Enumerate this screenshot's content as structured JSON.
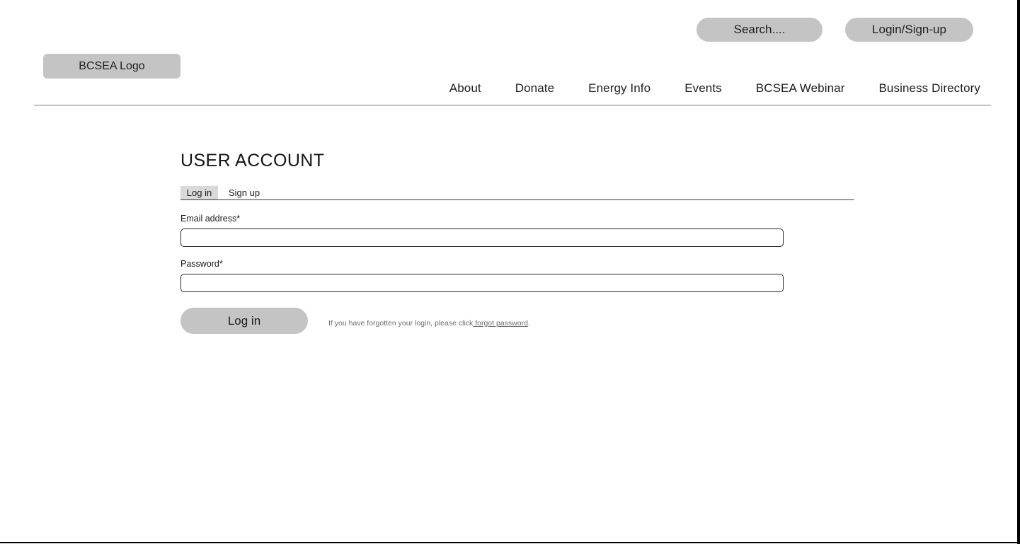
{
  "header": {
    "search_button": "Search....",
    "login_button": "Login/Sign-up",
    "logo": "BCSEA Logo",
    "nav": [
      {
        "label": "About"
      },
      {
        "label": "Donate"
      },
      {
        "label": "Energy Info"
      },
      {
        "label": "Events"
      },
      {
        "label": "BCSEA Webinar"
      },
      {
        "label": "Business Directory"
      }
    ]
  },
  "main": {
    "title": "USER ACCOUNT",
    "tabs": [
      {
        "label": "Log in",
        "active": true
      },
      {
        "label": "Sign up",
        "active": false
      }
    ],
    "form": {
      "email_label": "Email address*",
      "email_value": "",
      "email_placeholder": "",
      "password_label": "Password*",
      "password_value": "",
      "password_placeholder": "",
      "submit_label": "Log in",
      "helper_prefix": "If you have forgotten your login, please click",
      "helper_link": " forgot password",
      "helper_suffix": "."
    }
  },
  "colors": {
    "button_gray": "#c4c4c4",
    "tab_active_gray": "#d9d9d9",
    "rule_gray": "#a8a8a8",
    "text_dark": "#1d1d1d",
    "helper_gray": "#6d6d6d"
  }
}
